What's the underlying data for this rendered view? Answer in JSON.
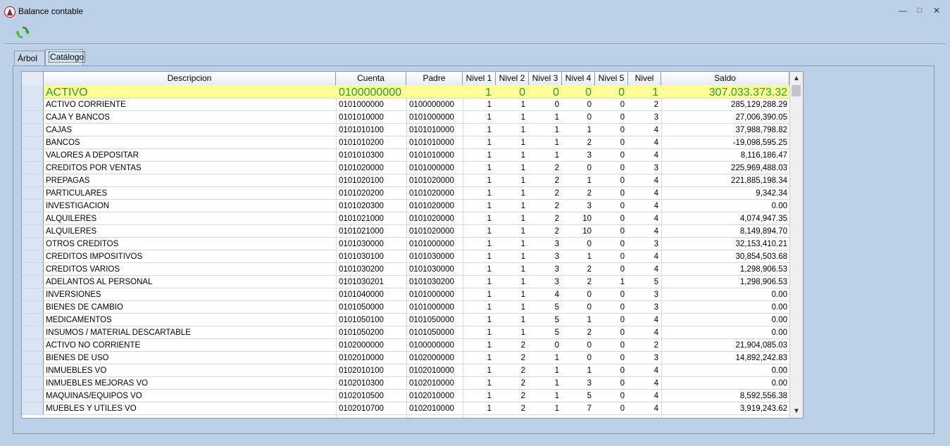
{
  "window": {
    "title": "Balance  contable",
    "minimize": "—",
    "restore": "□",
    "close": "✕"
  },
  "toolbar": {
    "refresh_icon": "refresh-icon"
  },
  "tabs": [
    {
      "label": "Árbol"
    },
    {
      "label": "Catálogo"
    }
  ],
  "columns": {
    "desc": "Descripcion",
    "cuenta": "Cuenta",
    "padre": "Padre",
    "n1": "Nivel 1",
    "n2": "Nivel 2",
    "n3": "Nivel 3",
    "n4": "Nivel 4",
    "n5": "Nivel 5",
    "niv": "Nivel",
    "saldo": "Saldo"
  },
  "rows": [
    {
      "desc": "ACTIVO",
      "cuenta": "0100000000",
      "padre": "",
      "n1": "1",
      "n2": "0",
      "n3": "0",
      "n4": "0",
      "n5": "0",
      "niv": "1",
      "saldo": "307.033.373.32"
    },
    {
      "desc": "ACTIVO CORRIENTE",
      "cuenta": "0101000000",
      "padre": "0100000000",
      "n1": "1",
      "n2": "1",
      "n3": "0",
      "n4": "0",
      "n5": "0",
      "niv": "2",
      "saldo": "285,129,288.29"
    },
    {
      "desc": "CAJA Y BANCOS",
      "cuenta": "0101010000",
      "padre": "0101000000",
      "n1": "1",
      "n2": "1",
      "n3": "1",
      "n4": "0",
      "n5": "0",
      "niv": "3",
      "saldo": "27,006,390.05"
    },
    {
      "desc": "CAJAS",
      "cuenta": "0101010100",
      "padre": "0101010000",
      "n1": "1",
      "n2": "1",
      "n3": "1",
      "n4": "1",
      "n5": "0",
      "niv": "4",
      "saldo": "37,988,798.82"
    },
    {
      "desc": "BANCOS",
      "cuenta": "0101010200",
      "padre": "0101010000",
      "n1": "1",
      "n2": "1",
      "n3": "1",
      "n4": "2",
      "n5": "0",
      "niv": "4",
      "saldo": "-19,098,595.25"
    },
    {
      "desc": "VALORES A DEPOSITAR",
      "cuenta": "0101010300",
      "padre": "0101010000",
      "n1": "1",
      "n2": "1",
      "n3": "1",
      "n4": "3",
      "n5": "0",
      "niv": "4",
      "saldo": "8,116,186.47"
    },
    {
      "desc": "CREDITOS POR VENTAS",
      "cuenta": "0101020000",
      "padre": "0101000000",
      "n1": "1",
      "n2": "1",
      "n3": "2",
      "n4": "0",
      "n5": "0",
      "niv": "3",
      "saldo": "225,969,488.03"
    },
    {
      "desc": "PREPAGAS",
      "cuenta": "0101020100",
      "padre": "0101020000",
      "n1": "1",
      "n2": "1",
      "n3": "2",
      "n4": "1",
      "n5": "0",
      "niv": "4",
      "saldo": "221,885,198.34"
    },
    {
      "desc": "PARTICULARES",
      "cuenta": "0101020200",
      "padre": "0101020000",
      "n1": "1",
      "n2": "1",
      "n3": "2",
      "n4": "2",
      "n5": "0",
      "niv": "4",
      "saldo": "9,342.34"
    },
    {
      "desc": "INVESTIGACION",
      "cuenta": "0101020300",
      "padre": "0101020000",
      "n1": "1",
      "n2": "1",
      "n3": "2",
      "n4": "3",
      "n5": "0",
      "niv": "4",
      "saldo": "0.00"
    },
    {
      "desc": "ALQUILERES",
      "cuenta": "0101021000",
      "padre": "0101020000",
      "n1": "1",
      "n2": "1",
      "n3": "2",
      "n4": "10",
      "n5": "0",
      "niv": "4",
      "saldo": "4,074,947.35"
    },
    {
      "desc": "ALQUILERES",
      "cuenta": "0101021000",
      "padre": "0101020000",
      "n1": "1",
      "n2": "1",
      "n3": "2",
      "n4": "10",
      "n5": "0",
      "niv": "4",
      "saldo": "8,149,894.70"
    },
    {
      "desc": "OTROS CREDITOS",
      "cuenta": "0101030000",
      "padre": "0101000000",
      "n1": "1",
      "n2": "1",
      "n3": "3",
      "n4": "0",
      "n5": "0",
      "niv": "3",
      "saldo": "32,153,410.21"
    },
    {
      "desc": "CREDITOS IMPOSITIVOS",
      "cuenta": "0101030100",
      "padre": "0101030000",
      "n1": "1",
      "n2": "1",
      "n3": "3",
      "n4": "1",
      "n5": "0",
      "niv": "4",
      "saldo": "30,854,503.68"
    },
    {
      "desc": "CREDITOS VARIOS",
      "cuenta": "0101030200",
      "padre": "0101030000",
      "n1": "1",
      "n2": "1",
      "n3": "3",
      "n4": "2",
      "n5": "0",
      "niv": "4",
      "saldo": "1,298,906.53"
    },
    {
      "desc": "ADELANTOS AL PERSONAL",
      "cuenta": "0101030201",
      "padre": "0101030200",
      "n1": "1",
      "n2": "1",
      "n3": "3",
      "n4": "2",
      "n5": "1",
      "niv": "5",
      "saldo": "1,298,906.53"
    },
    {
      "desc": "INVERSIONES",
      "cuenta": "0101040000",
      "padre": "0101000000",
      "n1": "1",
      "n2": "1",
      "n3": "4",
      "n4": "0",
      "n5": "0",
      "niv": "3",
      "saldo": "0.00"
    },
    {
      "desc": "BIENES DE CAMBIO",
      "cuenta": "0101050000",
      "padre": "0101000000",
      "n1": "1",
      "n2": "1",
      "n3": "5",
      "n4": "0",
      "n5": "0",
      "niv": "3",
      "saldo": "0.00"
    },
    {
      "desc": "MEDICAMENTOS",
      "cuenta": "0101050100",
      "padre": "0101050000",
      "n1": "1",
      "n2": "1",
      "n3": "5",
      "n4": "1",
      "n5": "0",
      "niv": "4",
      "saldo": "0.00"
    },
    {
      "desc": "INSUMOS /  MATERIAL DESCARTABLE",
      "cuenta": "0101050200",
      "padre": "0101050000",
      "n1": "1",
      "n2": "1",
      "n3": "5",
      "n4": "2",
      "n5": "0",
      "niv": "4",
      "saldo": "0.00"
    },
    {
      "desc": "ACTIVO NO CORRIENTE",
      "cuenta": "0102000000",
      "padre": "0100000000",
      "n1": "1",
      "n2": "2",
      "n3": "0",
      "n4": "0",
      "n5": "0",
      "niv": "2",
      "saldo": "21,904,085.03"
    },
    {
      "desc": "BIENES DE USO",
      "cuenta": "0102010000",
      "padre": "0102000000",
      "n1": "1",
      "n2": "2",
      "n3": "1",
      "n4": "0",
      "n5": "0",
      "niv": "3",
      "saldo": "14,892,242.83"
    },
    {
      "desc": "INMUEBLES VO",
      "cuenta": "0102010100",
      "padre": "0102010000",
      "n1": "1",
      "n2": "2",
      "n3": "1",
      "n4": "1",
      "n5": "0",
      "niv": "4",
      "saldo": "0.00"
    },
    {
      "desc": "INMUEBLES MEJORAS VO",
      "cuenta": "0102010300",
      "padre": "0102010000",
      "n1": "1",
      "n2": "2",
      "n3": "1",
      "n4": "3",
      "n5": "0",
      "niv": "4",
      "saldo": "0.00"
    },
    {
      "desc": "MAQUINAS/EQUIPOS VO",
      "cuenta": "0102010500",
      "padre": "0102010000",
      "n1": "1",
      "n2": "2",
      "n3": "1",
      "n4": "5",
      "n5": "0",
      "niv": "4",
      "saldo": "8,592,556.38"
    },
    {
      "desc": "MUEBLES Y UTILES VO",
      "cuenta": "0102010700",
      "padre": "0102010000",
      "n1": "1",
      "n2": "2",
      "n3": "1",
      "n4": "7",
      "n5": "0",
      "niv": "4",
      "saldo": "3,919,243.62"
    }
  ],
  "scroll": {
    "up": "▲",
    "down": "▼"
  }
}
